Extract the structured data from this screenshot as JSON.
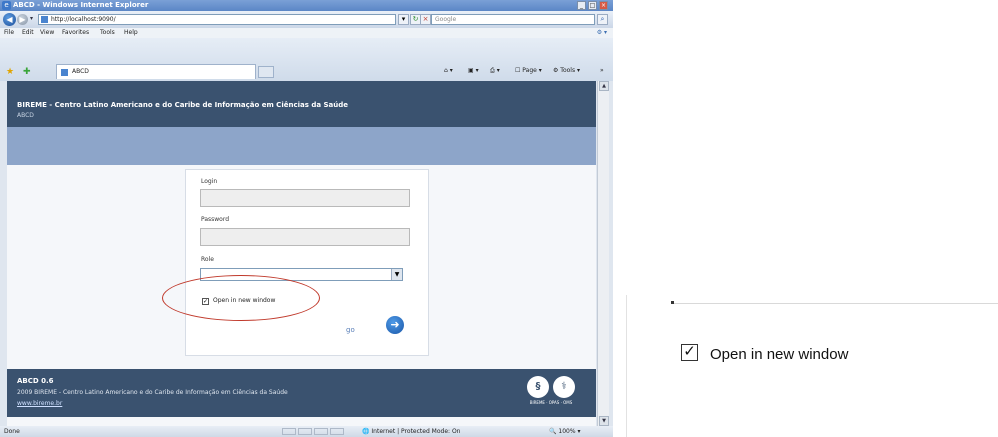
{
  "window": {
    "title": "ABCD - Windows Internet Explorer"
  },
  "address": {
    "url": "http://localhost:9090/",
    "search_placeholder": "Google"
  },
  "menu": [
    "File",
    "Edit",
    "View",
    "Favorites",
    "Tools",
    "Help"
  ],
  "tab": {
    "label": "ABCD"
  },
  "commands": {
    "page": "Page",
    "tools": "Tools"
  },
  "site": {
    "title": "BIREME - Centro Latino Americano e do Caribe de Informação em Ciências da Saúde",
    "subtitle": "ABCD"
  },
  "login": {
    "login_label": "Login",
    "password_label": "Password",
    "role_label": "Role",
    "role_value": "",
    "open_new_window_label": "Open in new window",
    "open_new_window_checked": true,
    "go_label": "go"
  },
  "footer": {
    "version": "ABCD 0.6",
    "copyright": "2009 BIREME - Centro Latino Americano e do Caribe de Informação em Ciências da Saúde",
    "link": "www.bireme.br",
    "logo_text": "BIREME · OPAS · OMS"
  },
  "status": {
    "left": "Done",
    "zone": "Internet | Protected Mode: On",
    "zoom": "100%"
  },
  "inset": {
    "checkbox_label": "Open in new window",
    "checked": true
  },
  "colors": {
    "header": "#3a526f",
    "band": "#8da5c9",
    "highlight": "#c0392b"
  }
}
